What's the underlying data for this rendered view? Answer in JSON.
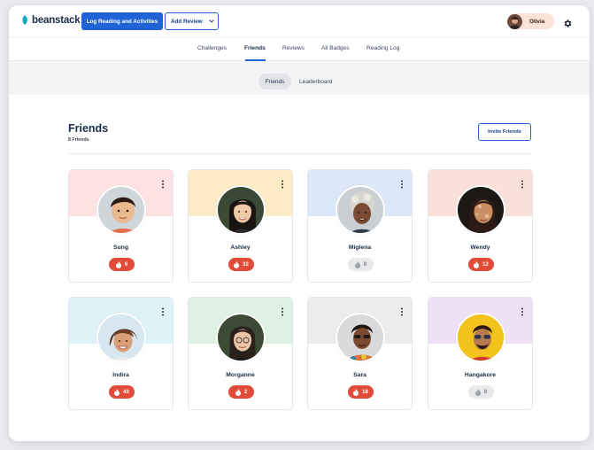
{
  "app": {
    "brand": "beanstack",
    "brand_color": "#1f63d6"
  },
  "header": {
    "log_button": "Log Reading and Activities",
    "review_button": "Add Review",
    "user_name": "Olivia",
    "icons": [
      "leaf-logo-icon",
      "chevron-down-icon",
      "gear-icon"
    ]
  },
  "nav": {
    "tabs": [
      {
        "label": "Challenges",
        "active": false
      },
      {
        "label": "Friends",
        "active": true
      },
      {
        "label": "Reviews",
        "active": false
      },
      {
        "label": "All Badges",
        "active": false
      },
      {
        "label": "Reading Log",
        "active": false
      }
    ]
  },
  "subnav": {
    "tabs": [
      {
        "label": "Friends",
        "active": true
      },
      {
        "label": "Leaderboard",
        "active": false
      }
    ]
  },
  "main": {
    "title": "Friends",
    "count": "8 Friends",
    "invite_button": "Invite Friends"
  },
  "friends": [
    {
      "name": "Sung",
      "streak": "6",
      "active": true,
      "band": "#fde1e3"
    },
    {
      "name": "Ashley",
      "streak": "32",
      "active": true,
      "band": "#fcebc4"
    },
    {
      "name": "Miglena",
      "streak": "0",
      "active": false,
      "band": "#dce7f8"
    },
    {
      "name": "Wendy",
      "streak": "12",
      "active": true,
      "band": "#fbe0da"
    },
    {
      "name": "Indira",
      "streak": "40",
      "active": true,
      "band": "#dff2f8"
    },
    {
      "name": "Morganne",
      "streak": "2",
      "active": true,
      "band": "#ddf1e4"
    },
    {
      "name": "Sara",
      "streak": "18",
      "active": true,
      "band": "#ececec"
    },
    {
      "name": "Hangakore",
      "streak": "0",
      "active": false,
      "band": "#f0e0f7"
    }
  ],
  "colors": {
    "streak_active": "#e14b3a",
    "streak_inactive": "#e8e9eb"
  }
}
